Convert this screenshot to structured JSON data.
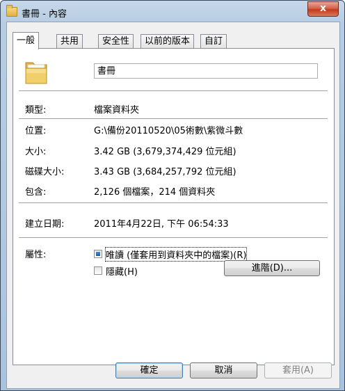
{
  "window": {
    "title": "書冊 - 內容",
    "close_label": "x"
  },
  "tabs": [
    {
      "label": "一般"
    },
    {
      "label": "共用"
    },
    {
      "label": "安全性"
    },
    {
      "label": "以前的版本"
    },
    {
      "label": "自訂"
    }
  ],
  "general": {
    "folder_name": "書冊",
    "type_label": "類型:",
    "type_value": "檔案資料夾",
    "location_label": "位置:",
    "location_value": "G:\\備份20110520\\05術數\\紫微斗數",
    "size_label": "大小:",
    "size_value": "3.42 GB (3,679,374,429 位元組)",
    "disk_size_label": "磁碟大小:",
    "disk_size_value": "3.43 GB (3,684,257,792 位元組)",
    "contains_label": "包含:",
    "contains_value": "2,126 個檔案，214 個資料夾",
    "created_label": "建立日期:",
    "created_value": "2011年4月22日, 下午 06:54:33",
    "attributes_label": "屬性:",
    "readonly_label": "唯讀 (僅套用到資料夾中的檔案)(R)",
    "hidden_label": "隱藏(H)",
    "advanced_button": "進階(D)..."
  },
  "buttons": {
    "ok": "確定",
    "cancel": "取消",
    "apply": "套用(A)"
  }
}
